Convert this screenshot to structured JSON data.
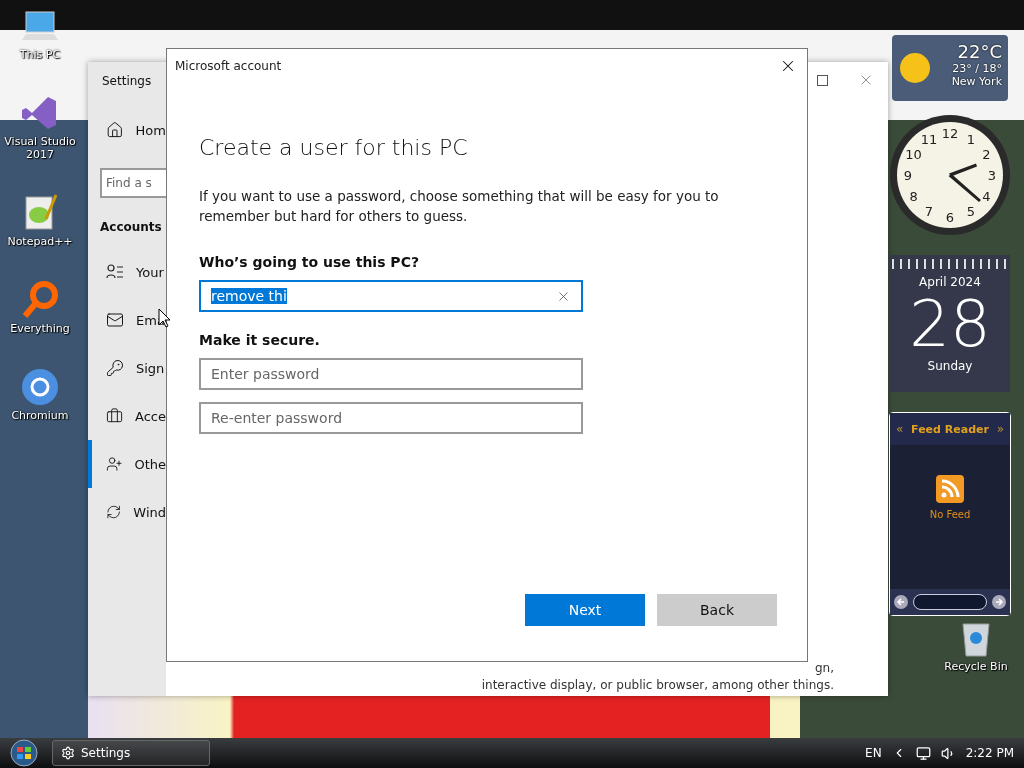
{
  "desktop_icons": [
    {
      "label": "This PC"
    },
    {
      "label": "Visual Studio 2017"
    },
    {
      "label": "Notepad++"
    },
    {
      "label": "Everything"
    },
    {
      "label": "Chromium"
    }
  ],
  "settings_window": {
    "title": "Settings",
    "home": "Hom",
    "search": {
      "placeholder": "Find a s"
    },
    "section": "Accounts",
    "nav_items": [
      {
        "label": "Your",
        "selected": false
      },
      {
        "label": "Ema",
        "selected": false
      },
      {
        "label": "Sign",
        "selected": false
      },
      {
        "label": "Acce",
        "selected": false
      },
      {
        "label": "Othe",
        "selected": true
      },
      {
        "label": "Wind",
        "selected": false
      }
    ],
    "body_text": [
      "gn,",
      "interactive display, or public browser, among other things."
    ]
  },
  "dialog": {
    "title": "Microsoft account",
    "heading": "Create a user for this PC",
    "description": "If you want to use a password, choose something that will be easy for you to remember but hard for others to guess.",
    "name_label": "Who’s going to use this PC?",
    "name_field": {
      "value": "remove thi"
    },
    "secure_label": "Make it secure.",
    "password_fields": [
      {
        "placeholder": "Enter password"
      },
      {
        "placeholder": "Re-enter password"
      }
    ],
    "buttons": [
      {
        "label": "Next",
        "kind": "primary"
      },
      {
        "label": "Back",
        "kind": "secondary"
      }
    ]
  },
  "gadgets": {
    "weather": {
      "temperature": "22°C",
      "range": "23° / 18°",
      "city": "New York"
    },
    "clock": {
      "numerals": [
        "11",
        "12",
        "1",
        "10",
        "2",
        "9",
        "3",
        "8",
        "4",
        "7",
        "5",
        "6"
      ]
    },
    "calendar": {
      "month": "April 2024",
      "day": "28",
      "weekday": "Sunday"
    },
    "feed_reader": {
      "prev": "«",
      "title": "Feed Reader",
      "next": "»",
      "status": "No Feed"
    }
  },
  "recycle_bin": {
    "label": "Recycle Bin"
  },
  "taskbar": {
    "tasks": [
      {
        "label": "Settings"
      }
    ],
    "language": "EN",
    "time": "2:22 PM"
  }
}
